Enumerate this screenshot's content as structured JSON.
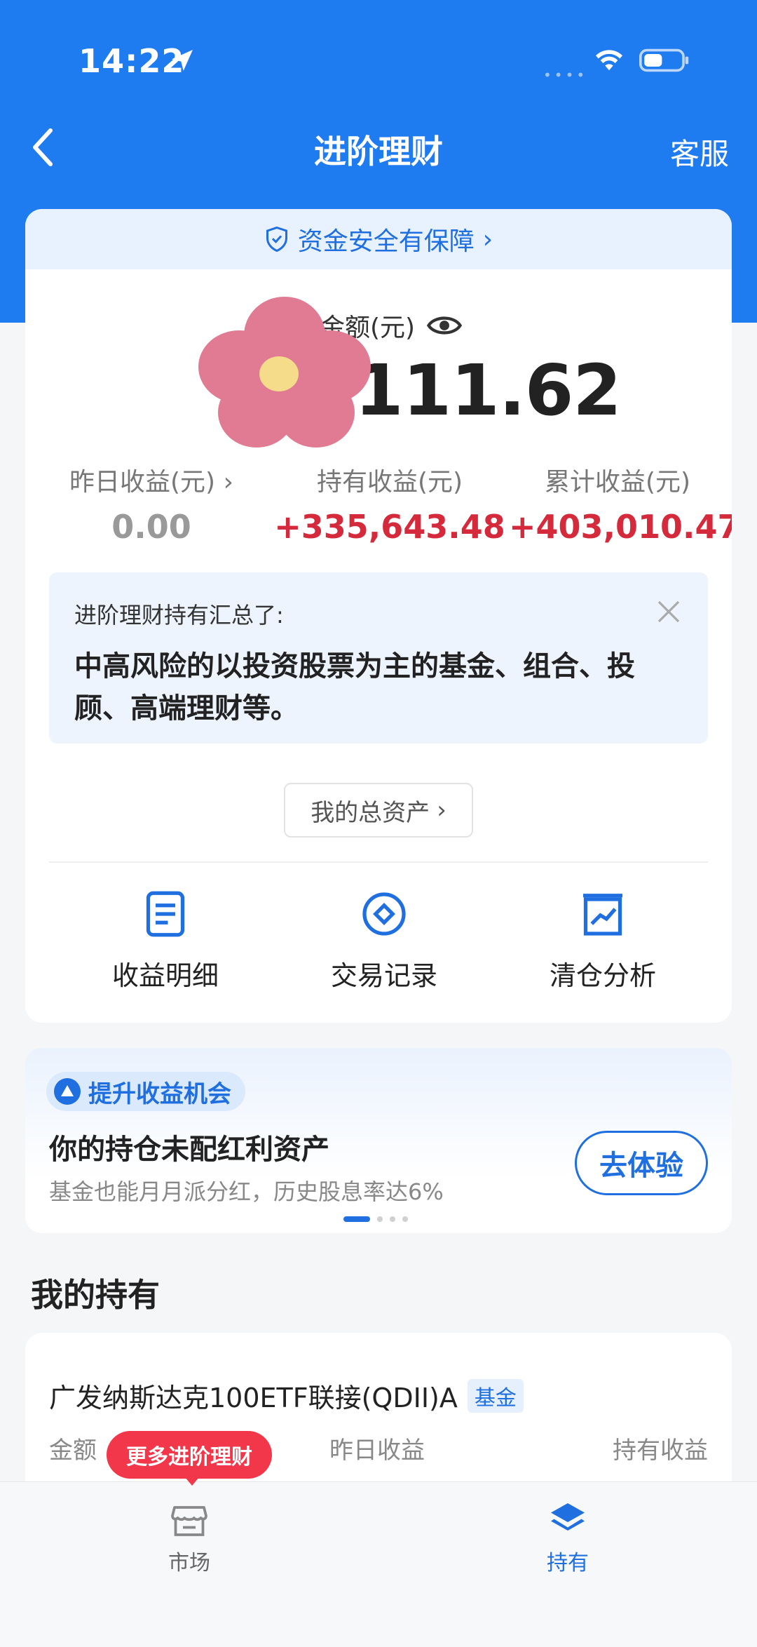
{
  "status_bar": {
    "time": "14:22"
  },
  "nav": {
    "title": "进阶理财",
    "service": "客服"
  },
  "security": {
    "label": "资金安全有保障"
  },
  "asset": {
    "label": "金额(元)",
    "value": "111.62"
  },
  "stats": [
    {
      "label": "昨日收益(元)",
      "value": "0.00"
    },
    {
      "label": "持有收益(元)",
      "value": "+335,643.48"
    },
    {
      "label": "累计收益(元)",
      "value": "+403,010.47"
    }
  ],
  "summary": {
    "title": "进阶理财持有汇总了:",
    "text": "中高风险的以投资股票为主的基金、组合、投顾、高端理财等。"
  },
  "total_assets_btn": "我的总资产",
  "actions": [
    {
      "label": "收益明细",
      "icon": "document-icon"
    },
    {
      "label": "交易记录",
      "icon": "diamond-circle-icon"
    },
    {
      "label": "清仓分析",
      "icon": "chart-icon"
    }
  ],
  "promo": {
    "tag": "提升收益机会",
    "title": "你的持仓未配红利资产",
    "subtitle": "基金也能月月派分红，历史股息率达6%",
    "button": "去体验"
  },
  "holdings": {
    "section_title": "我的持有",
    "fund_name": "广发纳斯达克100ETF联接(QDII)A",
    "badge": "基金",
    "columns": [
      "金额",
      "昨日收益",
      "持有收益"
    ]
  },
  "more_bubble": "更多进阶理财",
  "tabs": [
    {
      "label": "市场",
      "icon": "market-icon"
    },
    {
      "label": "持有",
      "icon": "layers-icon"
    }
  ],
  "colors": {
    "primary": "#1f7bf0",
    "gain": "#d42a3c",
    "bubble": "#f2374a"
  }
}
